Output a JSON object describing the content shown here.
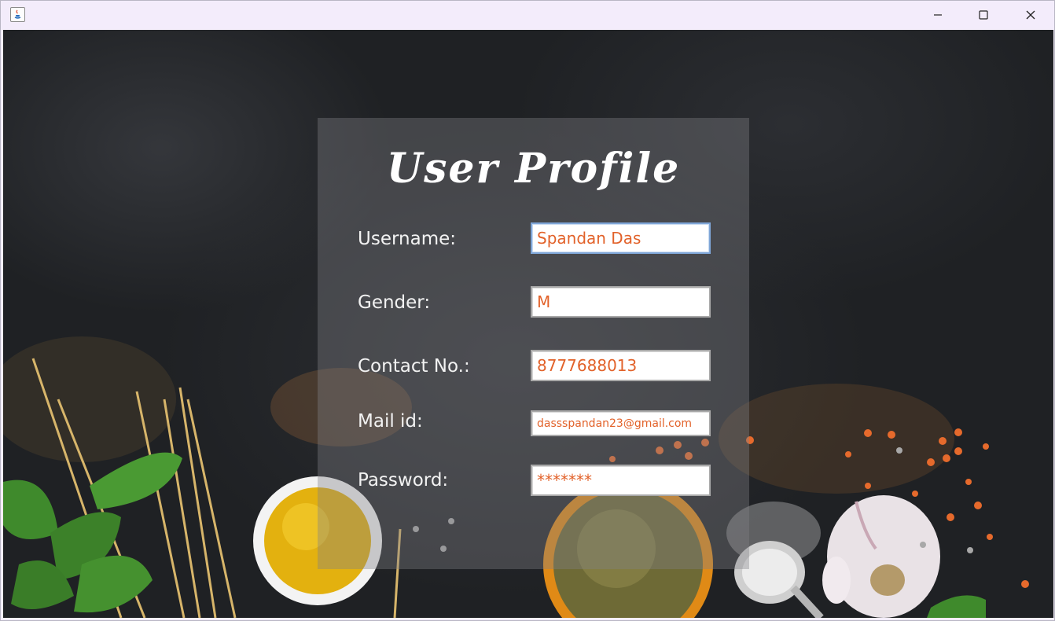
{
  "window": {
    "title": "",
    "controls": {
      "minimize": "minimize-icon",
      "maximize": "maximize-icon",
      "close": "close-icon"
    }
  },
  "form": {
    "title": "User Profile",
    "fields": [
      {
        "label": "Username:",
        "value": "Spandan Das"
      },
      {
        "label": "Gender:",
        "value": "M"
      },
      {
        "label": "Contact No.:",
        "value": "8777688013"
      },
      {
        "label": "Mail id:",
        "value": "dassspandan23@gmail.com"
      },
      {
        "label": "Password:",
        "value": "*******"
      }
    ]
  },
  "colors": {
    "input_text": "#e2622a",
    "panel_overlay": "rgba(130,130,135,0.38)",
    "background": "#1f2124"
  }
}
